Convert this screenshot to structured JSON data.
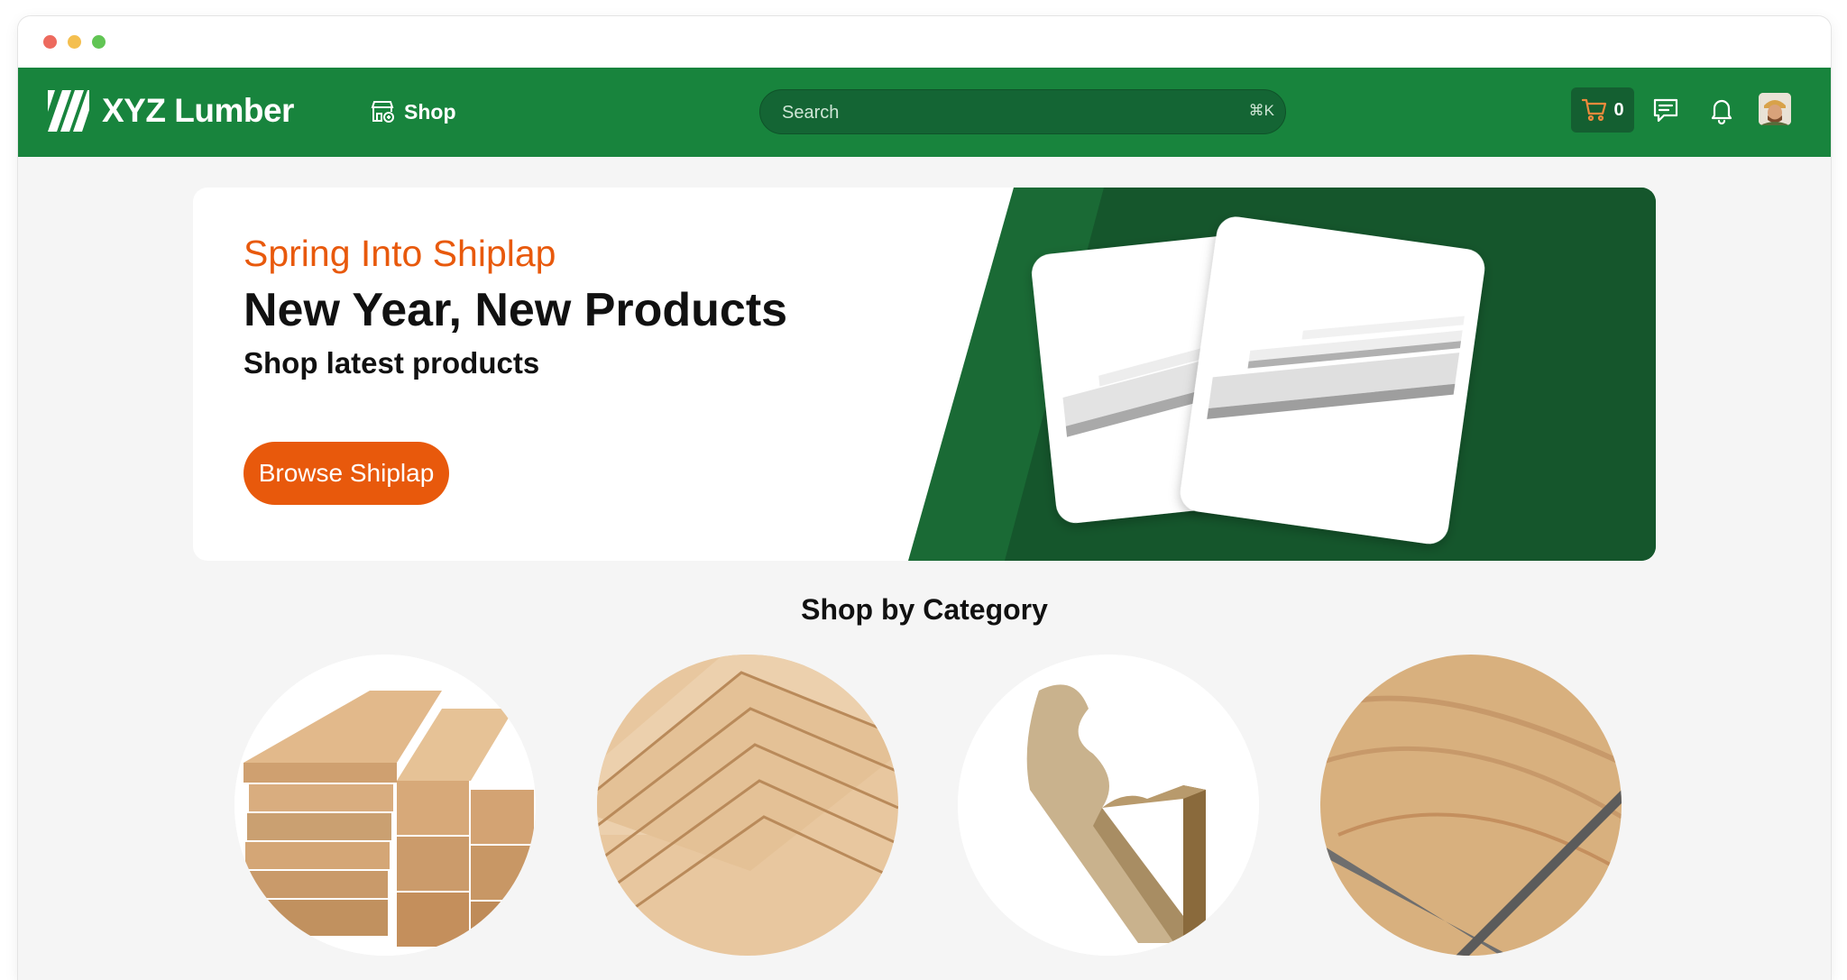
{
  "brand": {
    "name": "XYZ Lumber",
    "primary_color": "#18843d",
    "accent_color": "#e8590c"
  },
  "nav": {
    "shop_label": "Shop",
    "search": {
      "placeholder": "Search",
      "value": "",
      "shortcut": "⌘K"
    },
    "cart_count": "0",
    "icons": [
      "store-icon",
      "search-field",
      "cart-icon",
      "chat-icon",
      "bell-icon",
      "avatar"
    ]
  },
  "hero": {
    "eyebrow": "Spring Into Shiplap",
    "headline": "New Year, New Products",
    "subheadline": "Shop latest products",
    "cta_label": "Browse Shiplap"
  },
  "categories_section": {
    "title": "Shop by Category",
    "items": [
      {
        "image": "lumber-boards"
      },
      {
        "image": "plywood-sheets"
      },
      {
        "image": "moulding-trim"
      },
      {
        "image": "laminate-flooring"
      }
    ]
  }
}
